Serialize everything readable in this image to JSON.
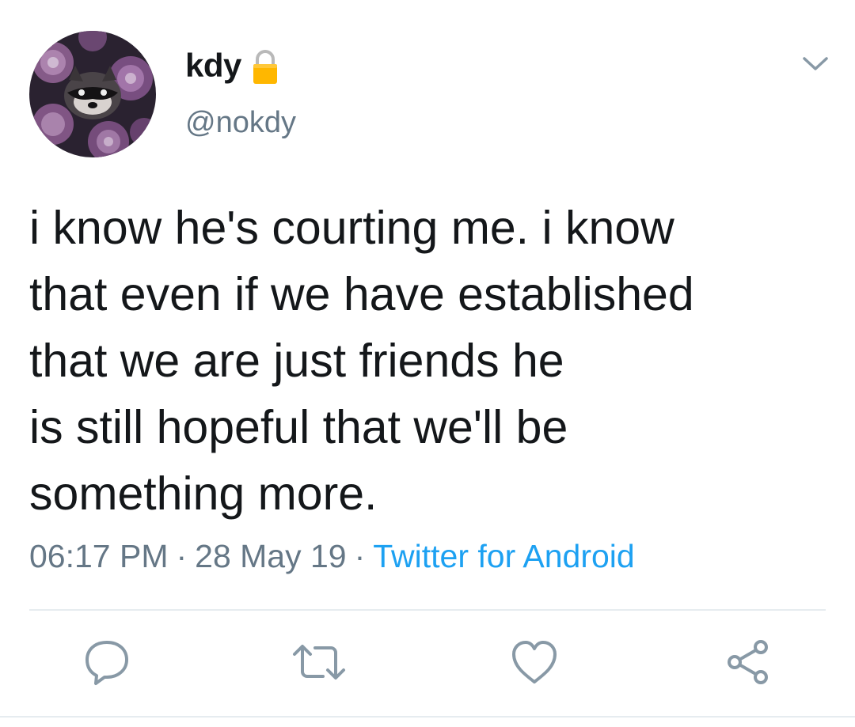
{
  "author": {
    "display_name": "kdy",
    "handle": "@nokdy",
    "protected_icon": "lock-icon",
    "avatar": "avatar-raccoon-succulents"
  },
  "menu_icon": "chevron-down-icon",
  "tweet": {
    "lines": [
      "i know he's courting me. i know",
      "that even if we have established",
      "that we are just friends he",
      "is still hopeful that we'll be",
      "something more."
    ]
  },
  "meta": {
    "time": "06:17 PM",
    "separator": "·",
    "date": "28 May 19",
    "source": "Twitter for Android"
  },
  "actions": [
    {
      "name": "reply",
      "icon": "reply-icon"
    },
    {
      "name": "retweet",
      "icon": "retweet-icon"
    },
    {
      "name": "like",
      "icon": "heart-icon"
    },
    {
      "name": "share",
      "icon": "share-icon"
    }
  ],
  "colors": {
    "text": "#14171a",
    "secondary": "#657786",
    "link": "#1da1f2",
    "divider": "#e6ecf0",
    "lock": "#ffb700"
  }
}
